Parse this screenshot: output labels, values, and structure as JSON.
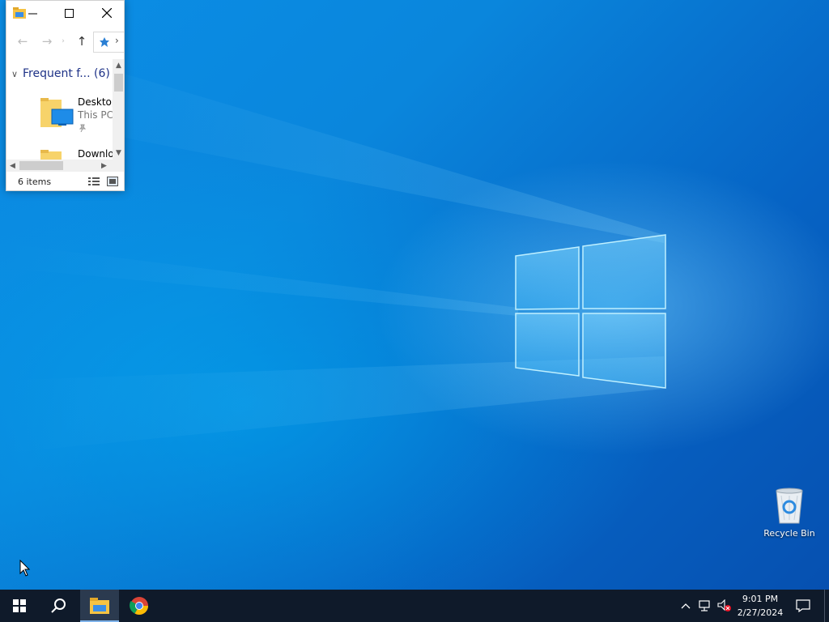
{
  "explorer": {
    "title_bar": {
      "minimize_icon": "minimize-icon",
      "maximize_icon": "maximize-icon",
      "close_icon": "close-icon"
    },
    "nav": {
      "back_icon": "back-arrow-icon",
      "forward_icon": "forward-arrow-icon",
      "recent_icon": "chevron-down-icon",
      "up_icon": "up-arrow-icon",
      "address_icon": "quick-access-pin-icon"
    },
    "group": {
      "label": "Frequent f...",
      "count": "(6)"
    },
    "items": [
      {
        "name": "Desktop",
        "location": "This PC",
        "pinned": true
      },
      {
        "name": "Downlo",
        "location": "",
        "pinned": false
      }
    ],
    "status": {
      "item_count": "6 items"
    }
  },
  "desktop": {
    "icons": [
      {
        "label": "Recycle Bin",
        "icon": "recycle-bin-icon"
      }
    ]
  },
  "taskbar": {
    "start_icon": "windows-start-icon",
    "search_icon": "search-icon",
    "pinned_apps": [
      {
        "icon": "file-explorer-icon",
        "running": true
      },
      {
        "icon": "chrome-icon",
        "running": false
      }
    ],
    "tray": {
      "overflow_icon": "chevron-up-icon",
      "network_icon": "network-icon",
      "volume_icon": "volume-muted-icon"
    },
    "clock": {
      "time": "9:01 PM",
      "date": "2/27/2024"
    },
    "notification_icon": "action-center-icon"
  },
  "colors": {
    "taskbar_bg": "#0f1a2a",
    "desktop_accent": "#0a86dc",
    "group_header": "#1e3287"
  }
}
